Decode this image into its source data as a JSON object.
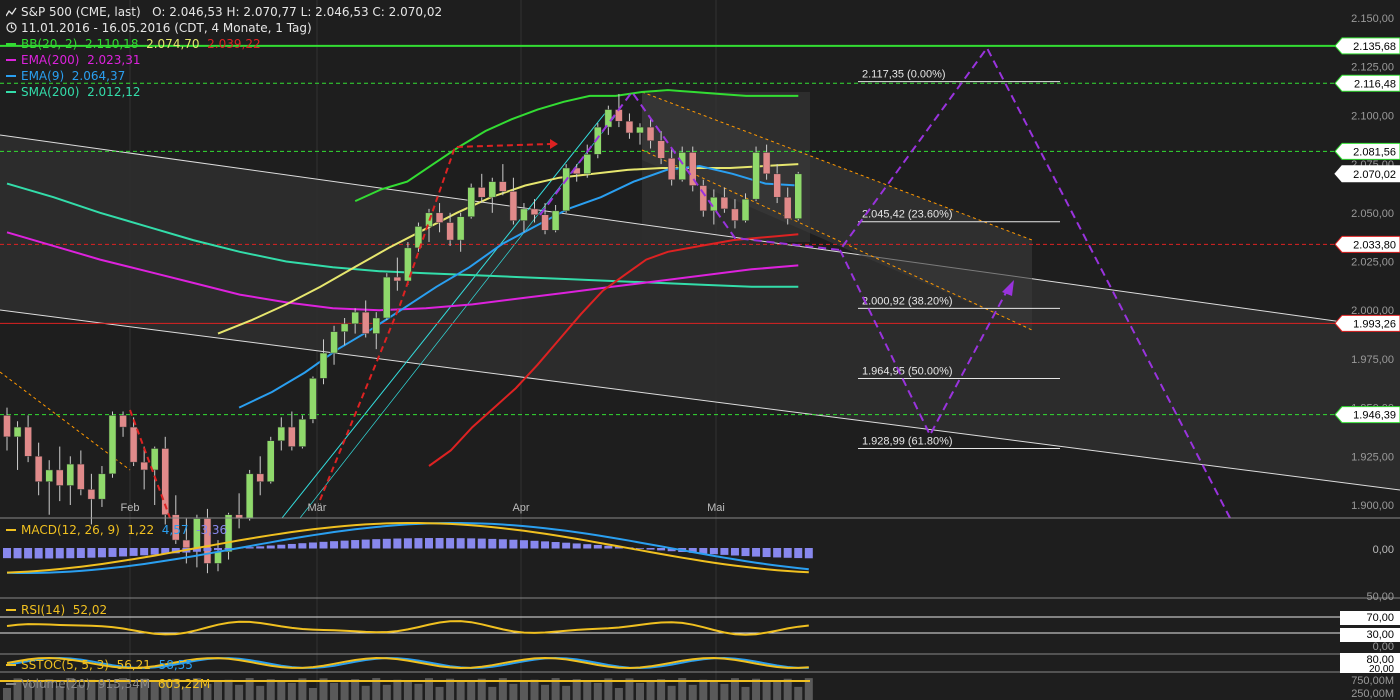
{
  "header": {
    "instrument": "S&P 500 (CME, last)",
    "ohlc": "O: 2.046,53  H: 2.070,77  L: 2.046,53  C: 2.070,02",
    "range": "11.01.2016 - 16.05.2016 (CDT, 4 Monate, 1 Tag)"
  },
  "legend": [
    {
      "name": "BB(20, 2)",
      "values": "2.110,18",
      "values2": "2.074,70",
      "values3": "2.039,22",
      "color": "#33dd33",
      "color2": "#e6e66e",
      "color3": "#dd2222"
    },
    {
      "name": "EMA(200)",
      "values": "2.023,31",
      "color": "#dd22dd"
    },
    {
      "name": "EMA(9)",
      "values": "2.064,37",
      "color": "#2a9ff0"
    },
    {
      "name": "SMA(200)",
      "values": "2.012,12",
      "color": "#33ddaa"
    }
  ],
  "macd_legend": {
    "name": "MACD(12, 26, 9)",
    "v1": "1,22",
    "v2": "4,57",
    "v3": "-3,36",
    "c1": "#f0c020",
    "c2": "#2a9ff0",
    "c3": "#8888ee"
  },
  "rsi_legend": {
    "name": "RSI(14)",
    "v1": "52,02",
    "c1": "#f0c020"
  },
  "sstoc_legend": {
    "name": "SSTOC(5, 5, 3)",
    "v1": "56,21",
    "v2": "58,55",
    "c1": "#f0c020",
    "c2": "#2a9ff0"
  },
  "volume_legend": {
    "name": "Volume(20)",
    "v1": "915,34M",
    "v2": "603,22M",
    "c1": "#888888",
    "c2": "#f0c020"
  },
  "chart_data": {
    "type": "candlestick",
    "title": "S&P 500 (CME, last)",
    "x_labels": [
      "Feb",
      "Mär",
      "Apr",
      "Mai"
    ],
    "y_axis_ticks": [
      "1.900,00",
      "1.925,00",
      "1.950,00",
      "1.975,00",
      "2.000,00",
      "2.025,00",
      "2.050,00",
      "2.075,00",
      "2.100,00",
      "2.125,00",
      "2.150,00"
    ],
    "ylim": [
      1900,
      2150
    ],
    "price_tags": [
      {
        "label": "2.135,68",
        "value": 2135.68,
        "color": "#33dd33"
      },
      {
        "label": "2.116,48",
        "value": 2116.48,
        "color": "#33dd33"
      },
      {
        "label": "2.081,56",
        "value": 2081.56,
        "color": "#33dd33"
      },
      {
        "label": "2.070,02",
        "value": 2070.02,
        "color": "#ffffff"
      },
      {
        "label": "2.033,80",
        "value": 2033.8,
        "color": "#dd2222"
      },
      {
        "label": "1.993,26",
        "value": 1993.26,
        "color": "#dd2222"
      },
      {
        "label": "1.946,39",
        "value": 1946.39,
        "color": "#33dd33"
      }
    ],
    "fibonacci": [
      {
        "label": "2.117,35 (0.00%)",
        "value": 2117.35
      },
      {
        "label": "2.045,42 (23.60%)",
        "value": 2045.42
      },
      {
        "label": "2.000,92 (38.20%)",
        "value": 2000.92
      },
      {
        "label": "1.964,95 (50.00%)",
        "value": 1964.95
      },
      {
        "label": "1.928,99 (61.80%)",
        "value": 1928.99
      }
    ],
    "candles": [
      [
        1946,
        1950,
        1928,
        1935
      ],
      [
        1935,
        1943,
        1918,
        1940
      ],
      [
        1940,
        1946,
        1922,
        1925
      ],
      [
        1925,
        1932,
        1905,
        1912
      ],
      [
        1912,
        1923,
        1895,
        1918
      ],
      [
        1918,
        1930,
        1902,
        1910
      ],
      [
        1910,
        1925,
        1900,
        1921
      ],
      [
        1921,
        1928,
        1905,
        1908
      ],
      [
        1908,
        1916,
        1890,
        1903
      ],
      [
        1903,
        1920,
        1899,
        1916
      ],
      [
        1916,
        1948,
        1914,
        1946
      ],
      [
        1946,
        1948,
        1935,
        1940
      ],
      [
        1940,
        1945,
        1920,
        1922
      ],
      [
        1922,
        1930,
        1908,
        1918
      ],
      [
        1918,
        1930,
        1900,
        1929
      ],
      [
        1929,
        1935,
        1890,
        1895
      ],
      [
        1895,
        1905,
        1880,
        1882
      ],
      [
        1882,
        1893,
        1870,
        1878
      ],
      [
        1878,
        1895,
        1868,
        1893
      ],
      [
        1893,
        1898,
        1865,
        1870
      ],
      [
        1870,
        1882,
        1866,
        1876
      ],
      [
        1876,
        1896,
        1872,
        1895
      ],
      [
        1895,
        1906,
        1888,
        1893
      ],
      [
        1893,
        1918,
        1892,
        1916
      ],
      [
        1916,
        1925,
        1905,
        1912
      ],
      [
        1912,
        1935,
        1911,
        1933
      ],
      [
        1933,
        1945,
        1928,
        1940
      ],
      [
        1940,
        1948,
        1928,
        1930
      ],
      [
        1930,
        1946,
        1929,
        1944
      ],
      [
        1944,
        1966,
        1942,
        1965
      ],
      [
        1965,
        1985,
        1962,
        1978
      ],
      [
        1978,
        1992,
        1972,
        1989
      ],
      [
        1989,
        1996,
        1982,
        1993
      ],
      [
        1993,
        2001,
        1988,
        1999
      ],
      [
        1999,
        2005,
        1986,
        1988
      ],
      [
        1988,
        1999,
        1980,
        1996
      ],
      [
        1996,
        2019,
        1995,
        2017
      ],
      [
        2017,
        2027,
        2010,
        2015
      ],
      [
        2015,
        2035,
        2013,
        2032
      ],
      [
        2032,
        2045,
        2030,
        2043
      ],
      [
        2043,
        2052,
        2035,
        2050
      ],
      [
        2050,
        2055,
        2040,
        2045
      ],
      [
        2045,
        2050,
        2033,
        2036
      ],
      [
        2036,
        2050,
        2030,
        2048
      ],
      [
        2048,
        2065,
        2047,
        2063
      ],
      [
        2063,
        2070,
        2055,
        2058
      ],
      [
        2058,
        2068,
        2050,
        2066
      ],
      [
        2066,
        2075,
        2059,
        2061
      ],
      [
        2061,
        2068,
        2044,
        2046
      ],
      [
        2046,
        2055,
        2040,
        2052
      ],
      [
        2052,
        2057,
        2045,
        2049
      ],
      [
        2049,
        2055,
        2039,
        2041
      ],
      [
        2041,
        2054,
        2040,
        2051
      ],
      [
        2051,
        2075,
        2050,
        2073
      ],
      [
        2073,
        2075,
        2066,
        2070
      ],
      [
        2070,
        2085,
        2068,
        2080
      ],
      [
        2080,
        2096,
        2078,
        2094
      ],
      [
        2094,
        2105,
        2090,
        2103
      ],
      [
        2103,
        2111,
        2094,
        2097
      ],
      [
        2097,
        2101,
        2088,
        2091
      ],
      [
        2091,
        2096,
        2085,
        2094
      ],
      [
        2094,
        2099,
        2083,
        2087
      ],
      [
        2087,
        2092,
        2075,
        2078
      ],
      [
        2078,
        2083,
        2064,
        2067
      ],
      [
        2067,
        2084,
        2066,
        2081
      ],
      [
        2081,
        2084,
        2061,
        2064
      ],
      [
        2064,
        2067,
        2048,
        2051
      ],
      [
        2051,
        2062,
        2044,
        2058
      ],
      [
        2058,
        2063,
        2050,
        2052
      ],
      [
        2052,
        2057,
        2042,
        2046
      ],
      [
        2046,
        2060,
        2045,
        2057
      ],
      [
        2057,
        2084,
        2056,
        2081
      ],
      [
        2081,
        2085,
        2067,
        2070
      ],
      [
        2070,
        2075,
        2055,
        2058
      ],
      [
        2058,
        2063,
        2044,
        2047
      ],
      [
        2047,
        2071,
        2046,
        2070
      ]
    ],
    "bb_upper": [
      2056,
      2062,
      2066,
      2075,
      2084,
      2092,
      2098,
      2103,
      2107,
      2110,
      2110,
      2112,
      2113,
      2112,
      2111,
      2110,
      2110,
      2110
    ],
    "bb_middle": [
      1988,
      1995,
      2003,
      2012,
      2022,
      2032,
      2041,
      2050,
      2058,
      2064,
      2068,
      2070,
      2072,
      2073,
      2073,
      2073,
      2074,
      2075
    ],
    "bb_lower": [
      1920,
      1928,
      1940,
      1950,
      1960,
      1972,
      1985,
      1998,
      2010,
      2018,
      2026,
      2030,
      2032,
      2034,
      2036,
      2037,
      2038,
      2039
    ],
    "ema9": [
      1950,
      1958,
      1968,
      1980,
      1990,
      2001,
      2012,
      2022,
      2034,
      2043,
      2052,
      2058,
      2066,
      2072,
      2074,
      2070,
      2065,
      2064
    ],
    "ema200": [
      2040,
      2033,
      2026,
      2020,
      2014,
      2008,
      2004,
      2001,
      2000,
      2001,
      2003,
      2006,
      2009,
      2012,
      2015,
      2018,
      2021,
      2023
    ],
    "sma200": [
      2065,
      2058,
      2050,
      2043,
      2036,
      2030,
      2025,
      2022,
      2020,
      2019,
      2018,
      2017,
      2016,
      2015,
      2014,
      2013,
      2012,
      2012
    ],
    "macd_panel_ticks": [
      "0,00"
    ],
    "rsi_panel_ticks": [
      "50,00",
      "70,00",
      "30,00",
      "0,00"
    ],
    "sstoc_panel_ticks": [
      "80,00",
      "20,00"
    ],
    "volume_panel_ticks": [
      "750,00M",
      "250,00M"
    ]
  }
}
